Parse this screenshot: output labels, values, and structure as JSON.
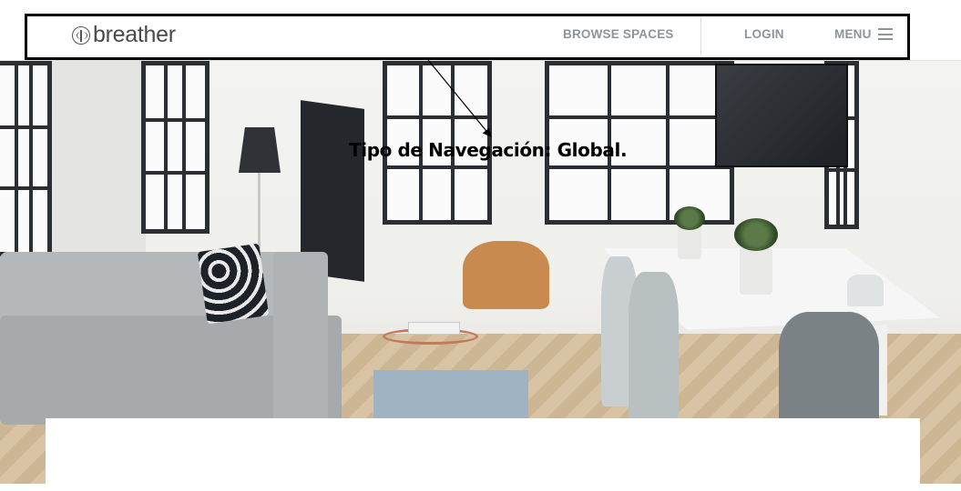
{
  "brand": {
    "logo_text": "breather",
    "logo_icon": "tree-icon"
  },
  "nav": {
    "browse_spaces": "BROWSE SPACES",
    "login": "LOGIN",
    "menu": "MENU",
    "menu_icon": "hamburger-icon"
  },
  "annotation": {
    "text": "Tipo de Navegación: Global."
  },
  "hero": {
    "image_description_icon": "living-room-photo"
  },
  "colors": {
    "nav_text": "#8e959a",
    "logo_text": "#4a4a4a",
    "highlight_border": "#000000"
  }
}
